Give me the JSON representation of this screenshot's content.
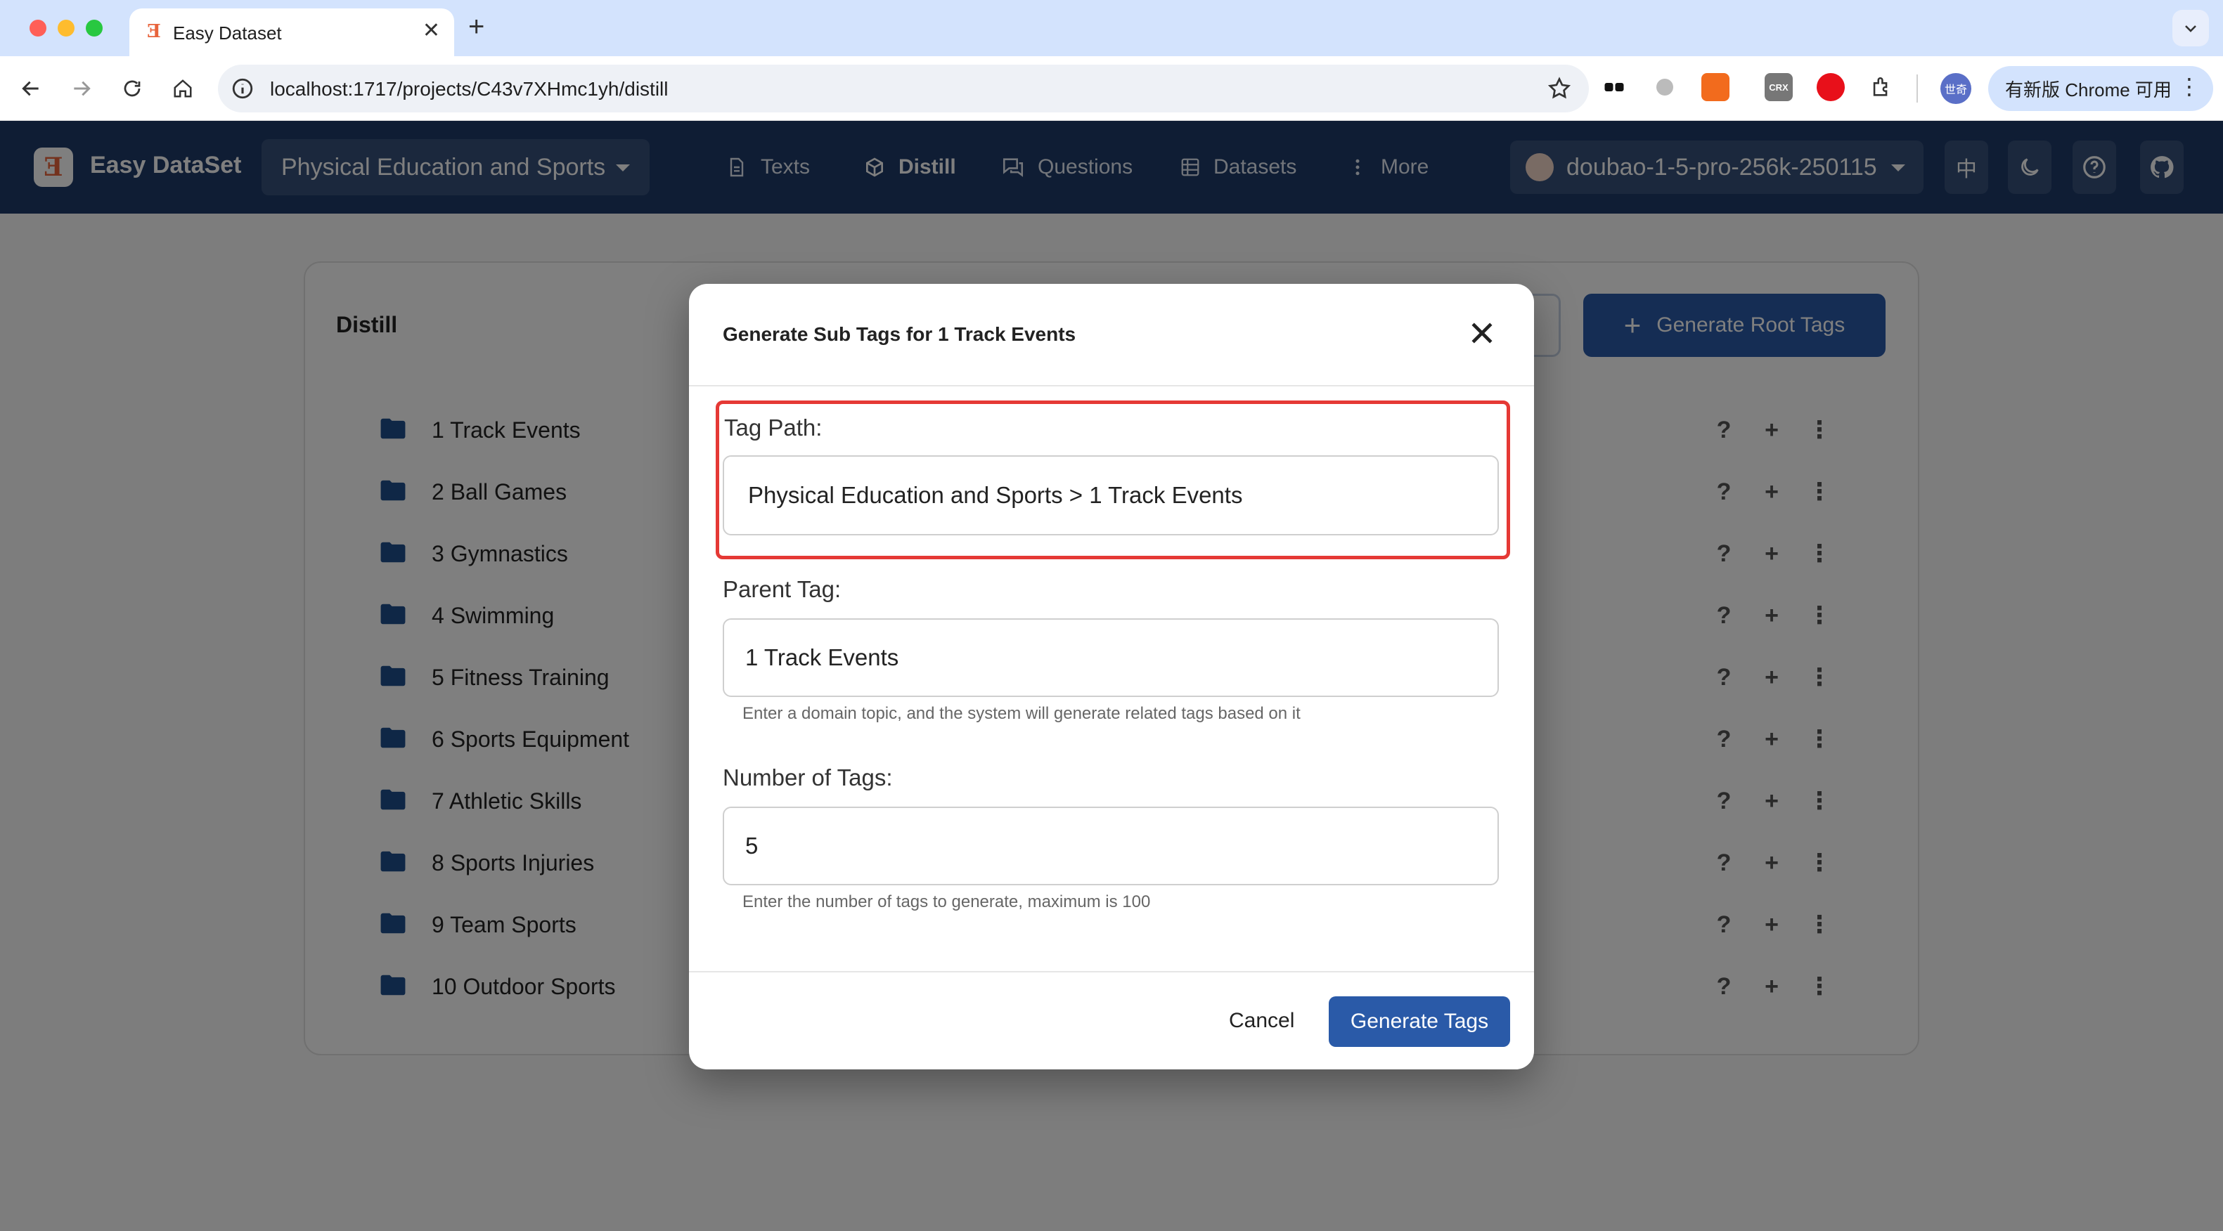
{
  "browser": {
    "tab_title": "Easy Dataset",
    "tab_favicon": "Ǝ",
    "url": "localhost:1717/projects/C43v7XHmc1yh/distill",
    "update_label": "有新版 Chrome 可用",
    "profile_label": "世奇",
    "ext_crx_label": "CRX"
  },
  "header": {
    "logo_glyph": "Ǝ",
    "app_name": "Easy DataSet",
    "project": "Physical Education and Sports",
    "nav": [
      {
        "label": "Texts",
        "icon": "document-icon"
      },
      {
        "label": "Distill",
        "icon": "cube-icon",
        "active": true
      },
      {
        "label": "Questions",
        "icon": "chat-icon"
      },
      {
        "label": "Datasets",
        "icon": "grid-icon"
      },
      {
        "label": "More",
        "icon": "more-vertical-icon"
      }
    ],
    "model": "doubao-1-5-pro-256k-250115",
    "lang_label": "中"
  },
  "main": {
    "title": "Distill",
    "generate_root_label": "Generate Root Tags",
    "tags": [
      "1 Track Events",
      "2 Ball Games",
      "3 Gymnastics",
      "4 Swimming",
      "5 Fitness Training",
      "6 Sports Equipment",
      "7 Athletic Skills",
      "8 Sports Injuries",
      "9 Team Sports",
      "10 Outdoor Sports"
    ],
    "row_action_help": "?",
    "row_action_add": "+",
    "row_action_more": "⋮"
  },
  "modal": {
    "title": "Generate Sub Tags for 1 Track Events",
    "tag_path_label": "Tag Path:",
    "tag_path_value": "Physical Education and Sports > 1 Track Events",
    "parent_tag_label": "Parent Tag:",
    "parent_tag_value": "1 Track Events",
    "parent_tag_helper": "Enter a domain topic, and the system will generate related tags based on it",
    "num_tags_label": "Number of Tags:",
    "num_tags_value": "5",
    "num_tags_helper": "Enter the number of tags to generate, maximum is 100",
    "cancel_label": "Cancel",
    "generate_label": "Generate Tags"
  },
  "colors": {
    "header_bg": "#1f3a68",
    "primary": "#2a5aa8",
    "highlight": "#e53935"
  }
}
